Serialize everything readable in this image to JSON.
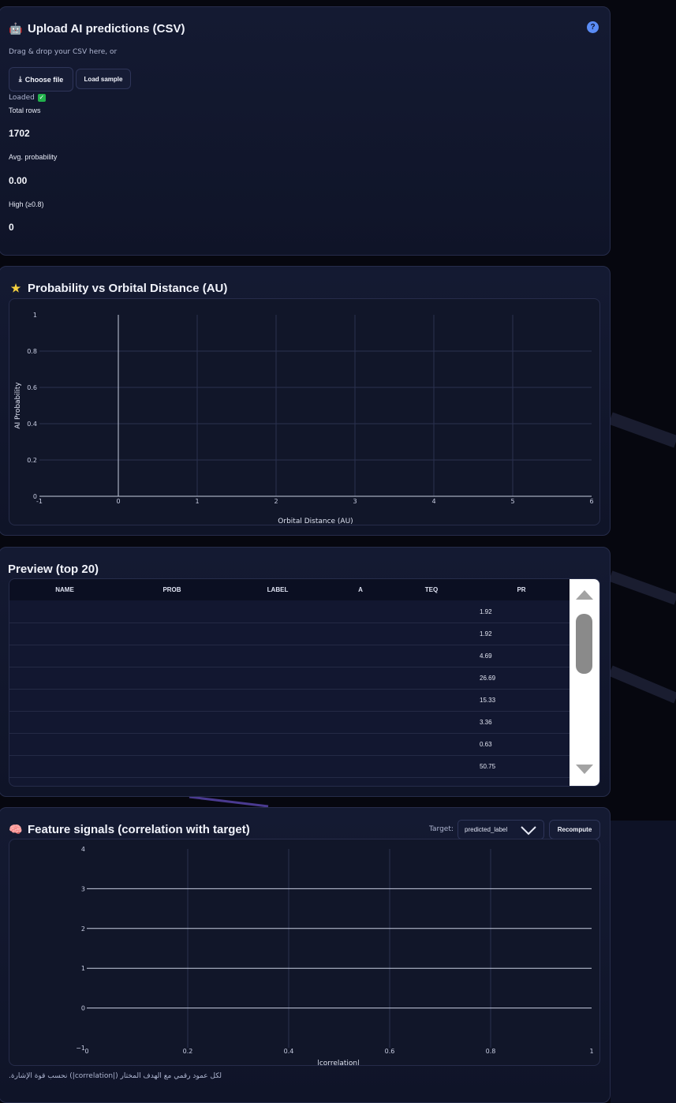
{
  "upload": {
    "title": "Upload AI predictions (CSV)",
    "icon": "robot-icon",
    "help": "?",
    "drop_text": "Drag & drop your CSV here, or",
    "choose_label": "Choose file",
    "choose_icon": "upload-arrow-icon",
    "sample_label": "Load sample",
    "status": "Loaded",
    "status_icon": "check-icon",
    "stats": [
      {
        "label": "Total rows",
        "value": "1702"
      },
      {
        "label": "Avg. probability",
        "value": "0.00"
      },
      {
        "label": "High (≥0.8)",
        "value": "0"
      }
    ]
  },
  "scatter": {
    "title": "Probability vs Orbital Distance (AU)",
    "icon": "star-icon"
  },
  "preview": {
    "title": "Preview (top 20)",
    "columns": [
      "NAME",
      "PROB",
      "LABEL",
      "A",
      "TEQ",
      "PR"
    ],
    "rows": [
      [
        "",
        "",
        "",
        "",
        "",
        "1.92"
      ],
      [
        "",
        "",
        "",
        "",
        "",
        "1.92"
      ],
      [
        "",
        "",
        "",
        "",
        "",
        "4.69"
      ],
      [
        "",
        "",
        "",
        "",
        "",
        "26.69"
      ],
      [
        "",
        "",
        "",
        "",
        "",
        "15.33"
      ],
      [
        "",
        "",
        "",
        "",
        "",
        "3.36"
      ],
      [
        "",
        "",
        "",
        "",
        "",
        "0.63"
      ],
      [
        "",
        "",
        "",
        "",
        "",
        "50.75"
      ]
    ]
  },
  "features": {
    "title": "Feature signals (correlation with target)",
    "icon": "brain-icon",
    "target_label": "Target:",
    "target_value": "predicted_label",
    "recompute_label": "Recompute",
    "footnote": "لكل عمود رقمي مع الهدف المختار (|correlation|) نحسب قوة الإشارة."
  },
  "chart_data": [
    {
      "type": "scatter",
      "title": "",
      "xlabel": "Orbital Distance (AU)",
      "ylabel": "AI Probability",
      "xlim": [
        -1,
        6
      ],
      "ylim": [
        0,
        1
      ],
      "x_ticks": [
        "-1",
        "0",
        "1",
        "2",
        "3",
        "4",
        "5",
        "6"
      ],
      "y_ticks": [
        "0",
        "0.2",
        "0.4",
        "0.6",
        "0.8",
        "1"
      ],
      "series": [],
      "grid": true
    },
    {
      "type": "bar",
      "orientation": "horizontal",
      "title": "",
      "xlabel": "|correlation|",
      "ylabel": "",
      "xlim": [
        0,
        1
      ],
      "ylim": [
        -1,
        4
      ],
      "x_ticks": [
        "0",
        "0.2",
        "0.4",
        "0.6",
        "0.8",
        "1"
      ],
      "y_ticks": [
        "−1",
        "0",
        "1",
        "2",
        "3",
        "4"
      ],
      "series": [],
      "grid": true
    }
  ],
  "colors": {
    "accent": "#5a8cf5",
    "card_bg": "#141a32",
    "page_bg": "#06070f"
  }
}
